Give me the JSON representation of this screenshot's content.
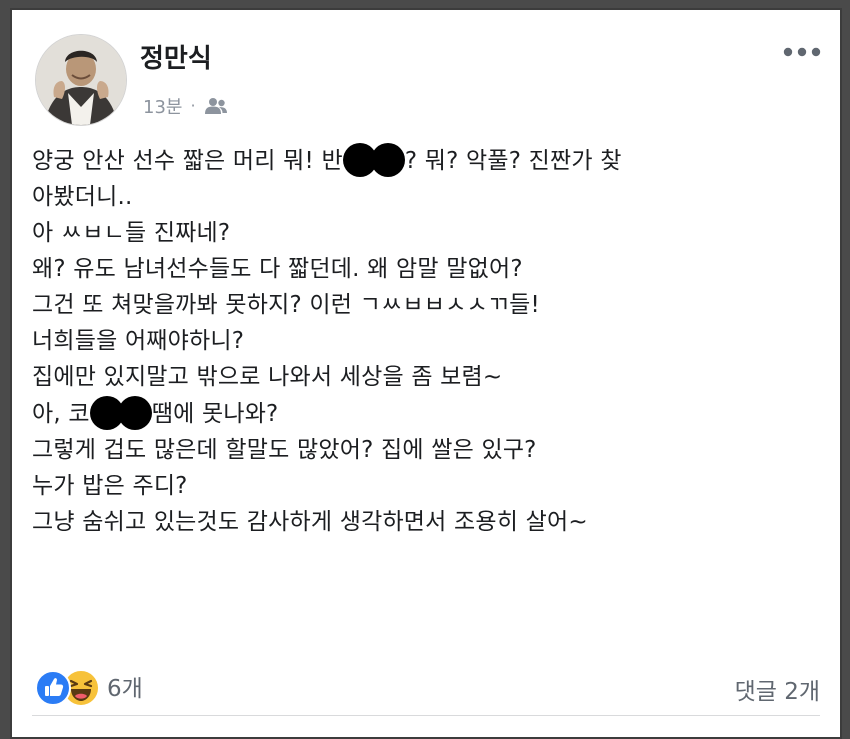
{
  "post": {
    "author": "정만식",
    "time": "13분",
    "separator": "·",
    "audience_icon": "friends-icon",
    "more_icon": "more-dots-icon",
    "lines": [
      {
        "pre": "양궁 안산 선수 짧은 머리 뭐! 반",
        "post": "? 뭐? 악풀? 진짠가 찾"
      },
      {
        "text": "아봤더니.."
      },
      {
        "text": "아 ㅆㅂㄴ들 진짜네?"
      },
      {
        "text": "왜? 유도 남녀선수들도 다 짧던데. 왜 암말 말없어?"
      },
      {
        "text": "그건 또 쳐맞을까봐 못하지? 이런 ㄱㅆㅂㅂㅅㅅㄲ들!"
      },
      {
        "text": "너희들을 어째야하니?"
      },
      {
        "text": "집에만 있지말고 밖으로 나와서 세상을 좀 보렴~"
      },
      {
        "pre": "아, 코",
        "post": "땜에 못나와?"
      },
      {
        "text": "그렇게 겁도 많은데 할말도 많았어? 집에 쌀은 있구?"
      },
      {
        "text": "누가 밥은 주디?"
      },
      {
        "text": "그냥 숨쉬고 있는것도 감사하게 생각하면서 조용히 살어~"
      }
    ],
    "reactions": {
      "icons": [
        "like-icon",
        "haha-icon"
      ],
      "count": "6개"
    },
    "comments": "댓글 2개"
  },
  "colors": {
    "like_blue": "#2b7cf5",
    "haha_yellow": "#f7c23a",
    "text": "#1c1e21",
    "muted": "#8d949e"
  }
}
